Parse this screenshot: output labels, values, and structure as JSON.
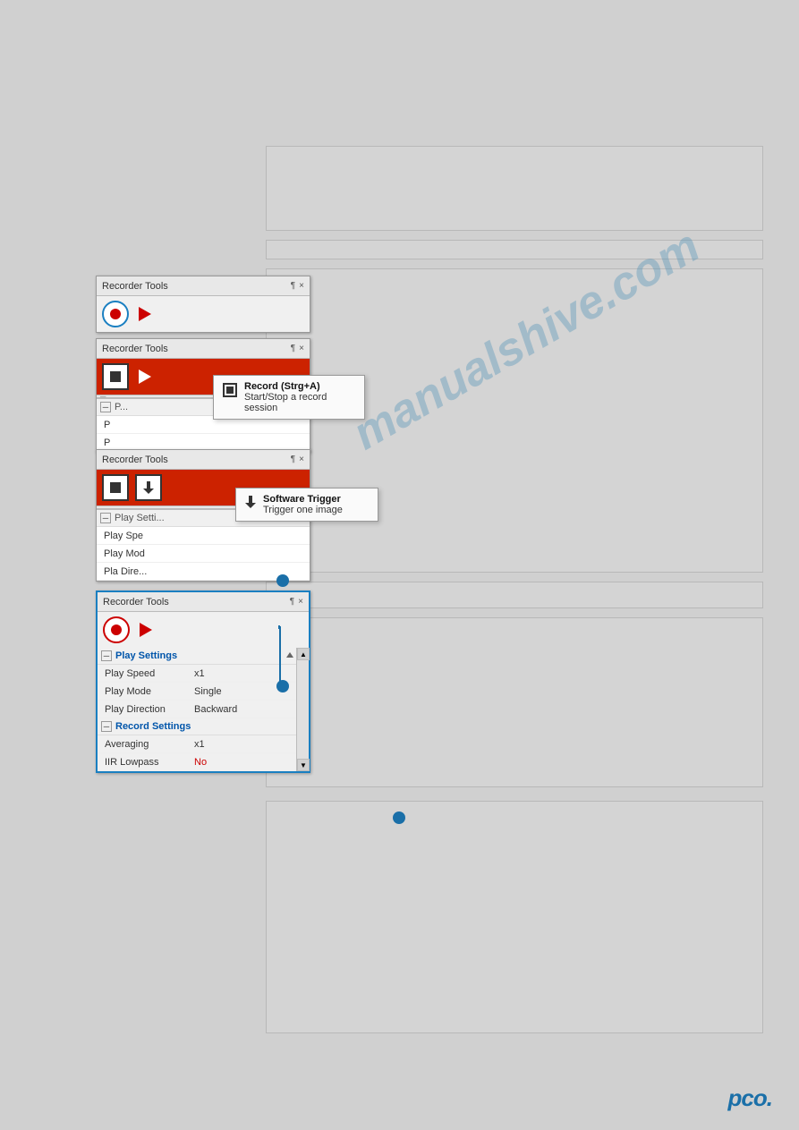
{
  "windows": {
    "window1": {
      "title": "Recorder Tools",
      "pin": "¶",
      "close": "×",
      "toolbar": {
        "record_state": "idle"
      }
    },
    "window2": {
      "title": "Recorder Tools",
      "pin": "¶",
      "close": "×",
      "toolbar": {
        "record_state": "active"
      },
      "tooltip": {
        "title": "Record (Strg+A)",
        "description": "Start/Stop a record session"
      }
    },
    "window3": {
      "title": "Recorder Tools",
      "pin": "¶",
      "close": "×",
      "toolbar": {
        "record_state": "active"
      },
      "tooltip": {
        "title": "Software Trigger",
        "description": "Trigger one image"
      }
    },
    "window4": {
      "title": "Recorder Tools",
      "pin": "¶",
      "close": "×",
      "toolbar": {
        "record_state": "idle"
      },
      "play_settings": {
        "label": "Play Settings",
        "items": [
          {
            "label": "Play Speed",
            "value": "x1"
          },
          {
            "label": "Play Mode",
            "value": "Single"
          },
          {
            "label": "Play Direction",
            "value": "Backward"
          }
        ]
      },
      "record_settings": {
        "label": "Record Settings",
        "items": [
          {
            "label": "Averaging",
            "value": "x1"
          },
          {
            "label": "IIR Lowpass",
            "value": "No",
            "highlight": true
          }
        ]
      }
    }
  },
  "watermark": "manualshive.com",
  "pco_logo": "pco."
}
